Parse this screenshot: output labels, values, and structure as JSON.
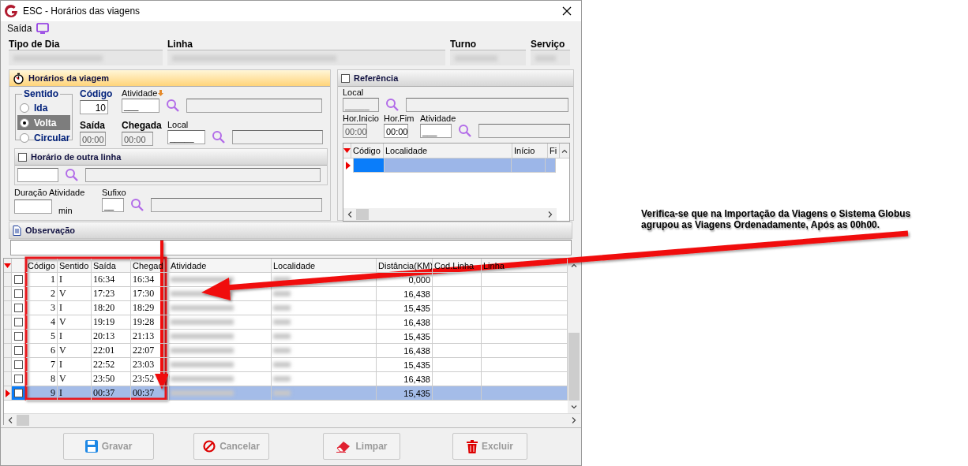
{
  "window": {
    "title": "ESC - Horários das viagens"
  },
  "menu": [
    {
      "label": "Saída"
    }
  ],
  "header": {
    "labels": [
      "Tipo de Dia",
      "Linha",
      "Turno",
      "Serviço"
    ]
  },
  "trip_panel": {
    "title": "Horários da viagem",
    "sentido": {
      "label": "Sentido",
      "options": [
        {
          "label": "Ida",
          "selected": false
        },
        {
          "label": "Volta",
          "selected": true
        },
        {
          "label": "Circular",
          "selected": false
        }
      ]
    },
    "codigo": {
      "label": "Código",
      "value": "10"
    },
    "atividade": {
      "label": "Atividade",
      "value": "___"
    },
    "saida": {
      "label": "Saída",
      "value": "00:00",
      "disabled": true
    },
    "chegada": {
      "label": "Chegada",
      "value": "00:00",
      "disabled": true
    },
    "local": {
      "label": "Local",
      "value": "_____"
    },
    "other_line": {
      "label": "Horário de outra linha",
      "checked": false
    },
    "duracao": {
      "label": "Duração Atividade",
      "unit": "min"
    },
    "sufixo": {
      "label": "Sufixo",
      "value": "__"
    }
  },
  "reference_panel": {
    "title": "Referência",
    "checked": false,
    "local": {
      "label": "Local",
      "value": "_____"
    },
    "hor_inicio": {
      "label": "Hor.Inicio",
      "value": "00:00",
      "disabled": true
    },
    "hor_fim": {
      "label": "Hor.Fim",
      "value": "00:00",
      "disabled": false
    },
    "atividade": {
      "label": "Atividade",
      "value": "___"
    },
    "table": {
      "columns": [
        "Código",
        "Localidade",
        "Início",
        "Fi"
      ],
      "rows": [
        {
          "selected": true
        }
      ]
    }
  },
  "observacao": {
    "title": "Observação"
  },
  "table": {
    "columns": [
      "Código",
      "Sentido",
      "Saída",
      "Chegad",
      "Atividade",
      "Localidade",
      "Distância(KM)",
      "Cod.Linha",
      "Linha"
    ],
    "rows": [
      {
        "codigo": "1",
        "sentido": "I",
        "saida": "16:34",
        "chegada": "16:34",
        "distancia": "0,000",
        "checked": false,
        "selected": false
      },
      {
        "codigo": "2",
        "sentido": "V",
        "saida": "17:23",
        "chegada": "17:30",
        "distancia": "16,438",
        "checked": false,
        "selected": false
      },
      {
        "codigo": "3",
        "sentido": "I",
        "saida": "18:20",
        "chegada": "18:29",
        "distancia": "15,435",
        "checked": false,
        "selected": false
      },
      {
        "codigo": "4",
        "sentido": "V",
        "saida": "19:19",
        "chegada": "19:28",
        "distancia": "16,438",
        "checked": false,
        "selected": false
      },
      {
        "codigo": "5",
        "sentido": "I",
        "saida": "20:13",
        "chegada": "21:13",
        "distancia": "15,435",
        "checked": false,
        "selected": false
      },
      {
        "codigo": "6",
        "sentido": "V",
        "saida": "22:01",
        "chegada": "22:07",
        "distancia": "16,438",
        "checked": false,
        "selected": false
      },
      {
        "codigo": "7",
        "sentido": "I",
        "saida": "22:52",
        "chegada": "23:03",
        "distancia": "15,435",
        "checked": false,
        "selected": false
      },
      {
        "codigo": "8",
        "sentido": "V",
        "saida": "23:50",
        "chegada": "23:52",
        "distancia": "16,438",
        "checked": false,
        "selected": false
      },
      {
        "codigo": "9",
        "sentido": "I",
        "saida": "00:37",
        "chegada": "00:37",
        "distancia": "15,435",
        "checked": false,
        "selected": true
      }
    ]
  },
  "buttons": [
    {
      "label": "Gravar",
      "kind": "save",
      "disabled": true
    },
    {
      "label": "Cancelar",
      "kind": "cancel",
      "disabled": true
    },
    {
      "label": "Limpar",
      "kind": "clear",
      "disabled": true
    },
    {
      "label": "Excluir",
      "kind": "delete",
      "disabled": true
    }
  ],
  "annotation": {
    "text": "Verifica-se que na Importação da Viagens o Sistema Globus agrupou as Viagens Ordenadamente, Após as 00h00."
  }
}
